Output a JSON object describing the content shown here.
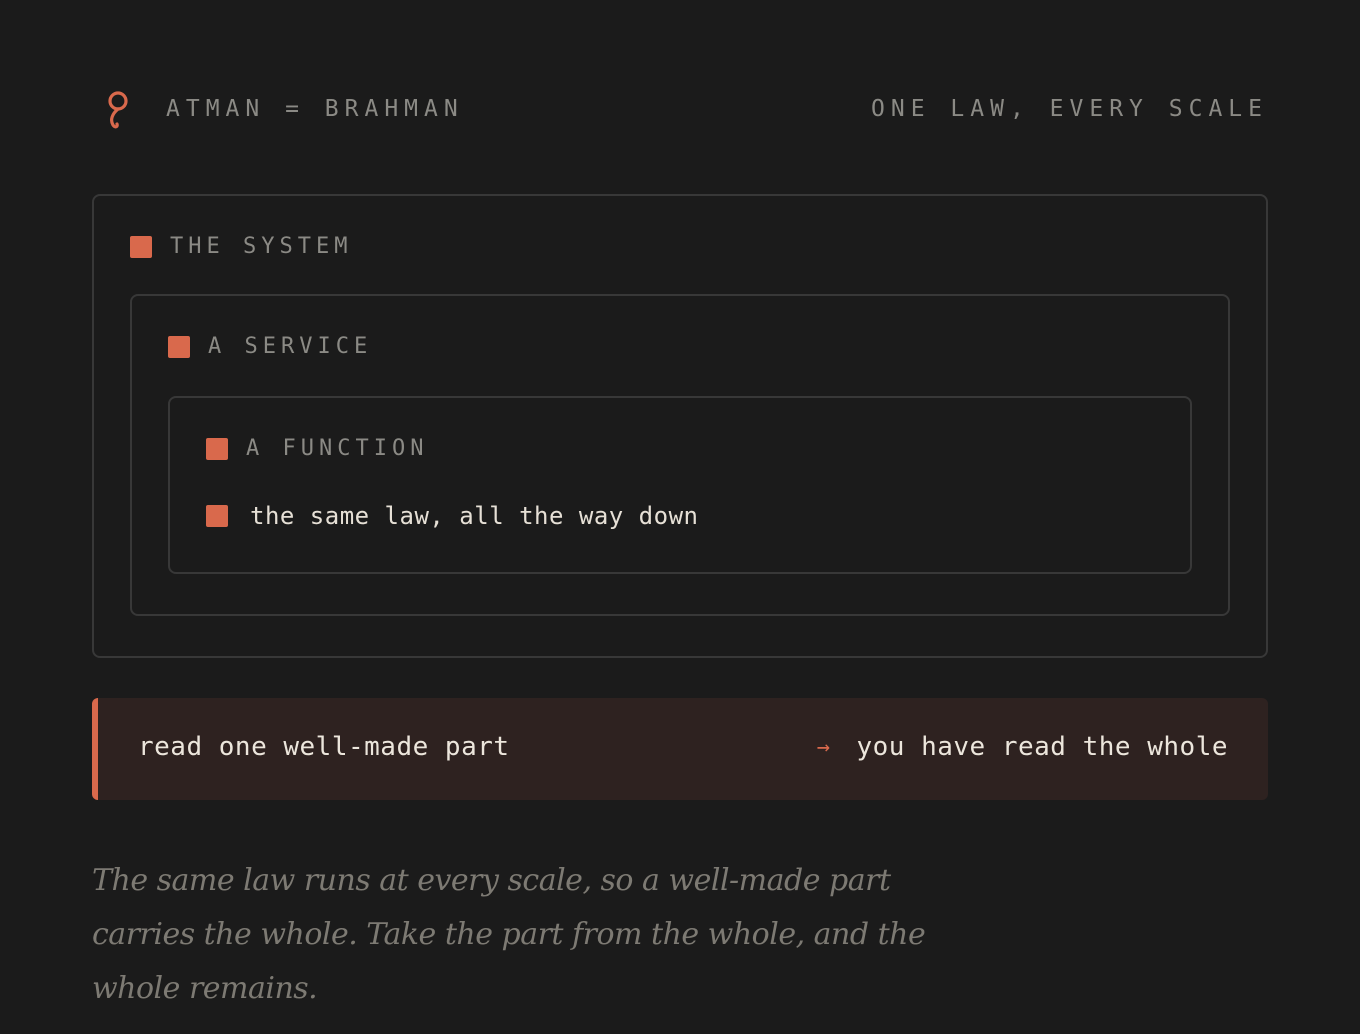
{
  "header": {
    "logo_icon": "ouroboros-glyph-icon",
    "brand": "ATMAN = BRAHMAN",
    "tagline": "ONE LAW, EVERY SCALE"
  },
  "levels": {
    "system": "THE SYSTEM",
    "service": "A SERVICE",
    "function": "A FUNCTION",
    "innermost": "the same law, all the way down"
  },
  "banner": {
    "left": "read one well-made part",
    "arrow": "→",
    "right": "you have read the whole"
  },
  "caption": "The same law runs at every scale, so a well-made part carries the whole. Take the part from the whole, and the whole remains.",
  "colors": {
    "background": "#1b1b1b",
    "accent": "#d9694c",
    "border": "#383838",
    "muted_text": "#8b8a85",
    "primary_text": "#e6e0d6",
    "banner_bg": "#2e2220"
  }
}
